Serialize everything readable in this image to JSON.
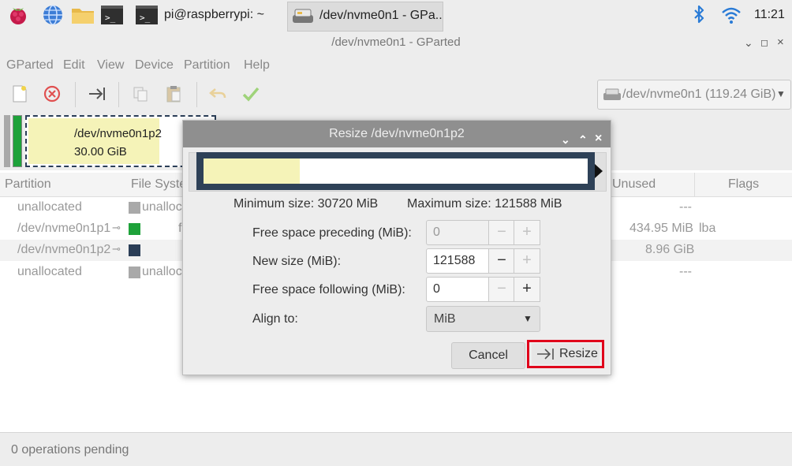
{
  "taskbar": {
    "terminal_task": "pi@raspberrypi: ~",
    "gparted_task": "/dev/nvme0n1 - GPa..",
    "clock": "11:21"
  },
  "window": {
    "title": "/dev/nvme0n1 - GParted",
    "menu": [
      "GParted",
      "Edit",
      "View",
      "Device",
      "Partition",
      "Help"
    ],
    "device_selector": "/dev/nvme0n1 (119.24 GiB)"
  },
  "disk_map": {
    "partition_name": "/dev/nvme0n1p2",
    "partition_size": "30.00 GiB"
  },
  "partition_list": {
    "headers": [
      "Partition",
      "File Syste",
      "Unused",
      "Flags"
    ],
    "rows": [
      {
        "partition": "unallocated",
        "filesystem": "unalloc",
        "unused": "---",
        "flags": ""
      },
      {
        "partition": "/dev/nvme0n1p1",
        "filesystem": "f",
        "unused": "434.95 MiB",
        "flags": "lba"
      },
      {
        "partition": "/dev/nvme0n1p2",
        "filesystem": "",
        "unused": "8.96 GiB",
        "flags": ""
      },
      {
        "partition": "unallocated",
        "filesystem": "unalloc",
        "unused": "---",
        "flags": ""
      }
    ]
  },
  "status": "0 operations pending",
  "dialog": {
    "title": "Resize /dev/nvme0n1p2",
    "min_size": "Minimum size: 30720 MiB",
    "max_size": "Maximum size: 121588 MiB",
    "free_preceding_label": "Free space preceding (MiB):",
    "free_preceding_value": "0",
    "new_size_label": "New size (MiB):",
    "new_size_value": "121588",
    "free_following_label": "Free space following (MiB):",
    "free_following_value": "0",
    "align_label": "Align to:",
    "align_value": "MiB",
    "cancel": "Cancel",
    "resize": "Resize",
    "used_fraction": 0.25
  },
  "colors": {
    "used_fill": "#f5f3b8",
    "border_dark": "#2e4157",
    "highlight": "#e0001b",
    "fat_green": "#1ea23a",
    "ext4_navy": "#2b3e57",
    "unalloc_gray": "#a9a9a9"
  }
}
